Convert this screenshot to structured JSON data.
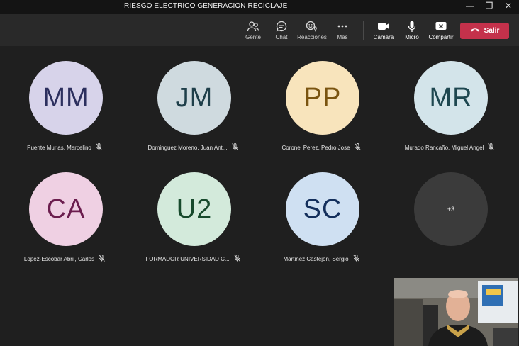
{
  "window": {
    "title": "RIESGO ELECTRICO GENERACION RECICLAJE"
  },
  "toolbar": {
    "gente": "Gente",
    "chat": "Chat",
    "reacciones": "Reacciones",
    "mas": "Más",
    "camara": "Cámara",
    "micro": "Micro",
    "compartir": "Compartir",
    "salir": "Salir"
  },
  "participants": [
    {
      "initials": "MM",
      "name": "Puente Murias, Marcelino",
      "bg": "#d7d3ea",
      "fg": "#2c2f5e"
    },
    {
      "initials": "JM",
      "name": "Dominguez Moreno, Juan Ant...",
      "bg": "#cfdadf",
      "fg": "#1f3f4a"
    },
    {
      "initials": "PP",
      "name": "Coronel Perez, Pedro Jose",
      "bg": "#f8e4bc",
      "fg": "#7a5410"
    },
    {
      "initials": "MR",
      "name": "Murado Rancaño, Miguel Angel",
      "bg": "#d3e4ea",
      "fg": "#1e4750"
    },
    {
      "initials": "CA",
      "name": "Lopez-Escobar Abril, Carlos",
      "bg": "#efd0e3",
      "fg": "#6b1d4e"
    },
    {
      "initials": "U2",
      "name": "FORMADOR UNIVERSIDAD C...",
      "bg": "#d3eadb",
      "fg": "#174a2c"
    },
    {
      "initials": "SC",
      "name": "Martinez Castejon, Sergio",
      "bg": "#cfe0f2",
      "fg": "#142f5c"
    }
  ],
  "overflow": {
    "label": "+3"
  }
}
